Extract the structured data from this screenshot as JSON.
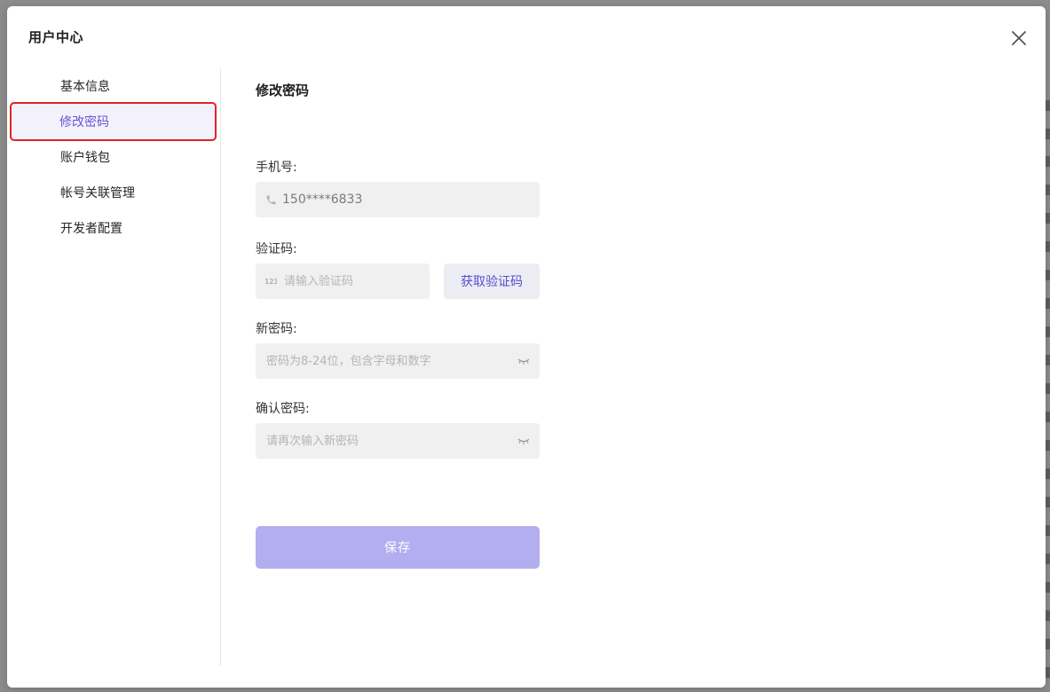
{
  "modal": {
    "title": "用户中心"
  },
  "sidebar": {
    "items": [
      {
        "label": "基本信息"
      },
      {
        "label": "修改密码"
      },
      {
        "label": "账户钱包"
      },
      {
        "label": "帐号关联管理"
      },
      {
        "label": "开发者配置"
      }
    ],
    "active_index": 1
  },
  "content": {
    "title": "修改密码",
    "phone": {
      "label": "手机号:",
      "value": "150****6833",
      "icon": "phone-icon"
    },
    "code": {
      "label": "验证码:",
      "placeholder": "请输入验证码",
      "icon": "number-123-icon",
      "button_label": "获取验证码"
    },
    "new_password": {
      "label": "新密码:",
      "placeholder": "密码为8-24位，包含字母和数字",
      "icon": "eye-closed-icon"
    },
    "confirm_password": {
      "label": "确认密码:",
      "placeholder": "请再次输入新密码",
      "icon": "eye-closed-icon"
    },
    "save_label": "保存"
  },
  "colors": {
    "accent": "#6a55d6",
    "save_button": "#b3aef0",
    "highlight_border": "#e02424",
    "field_bg": "#f0f0f0"
  }
}
